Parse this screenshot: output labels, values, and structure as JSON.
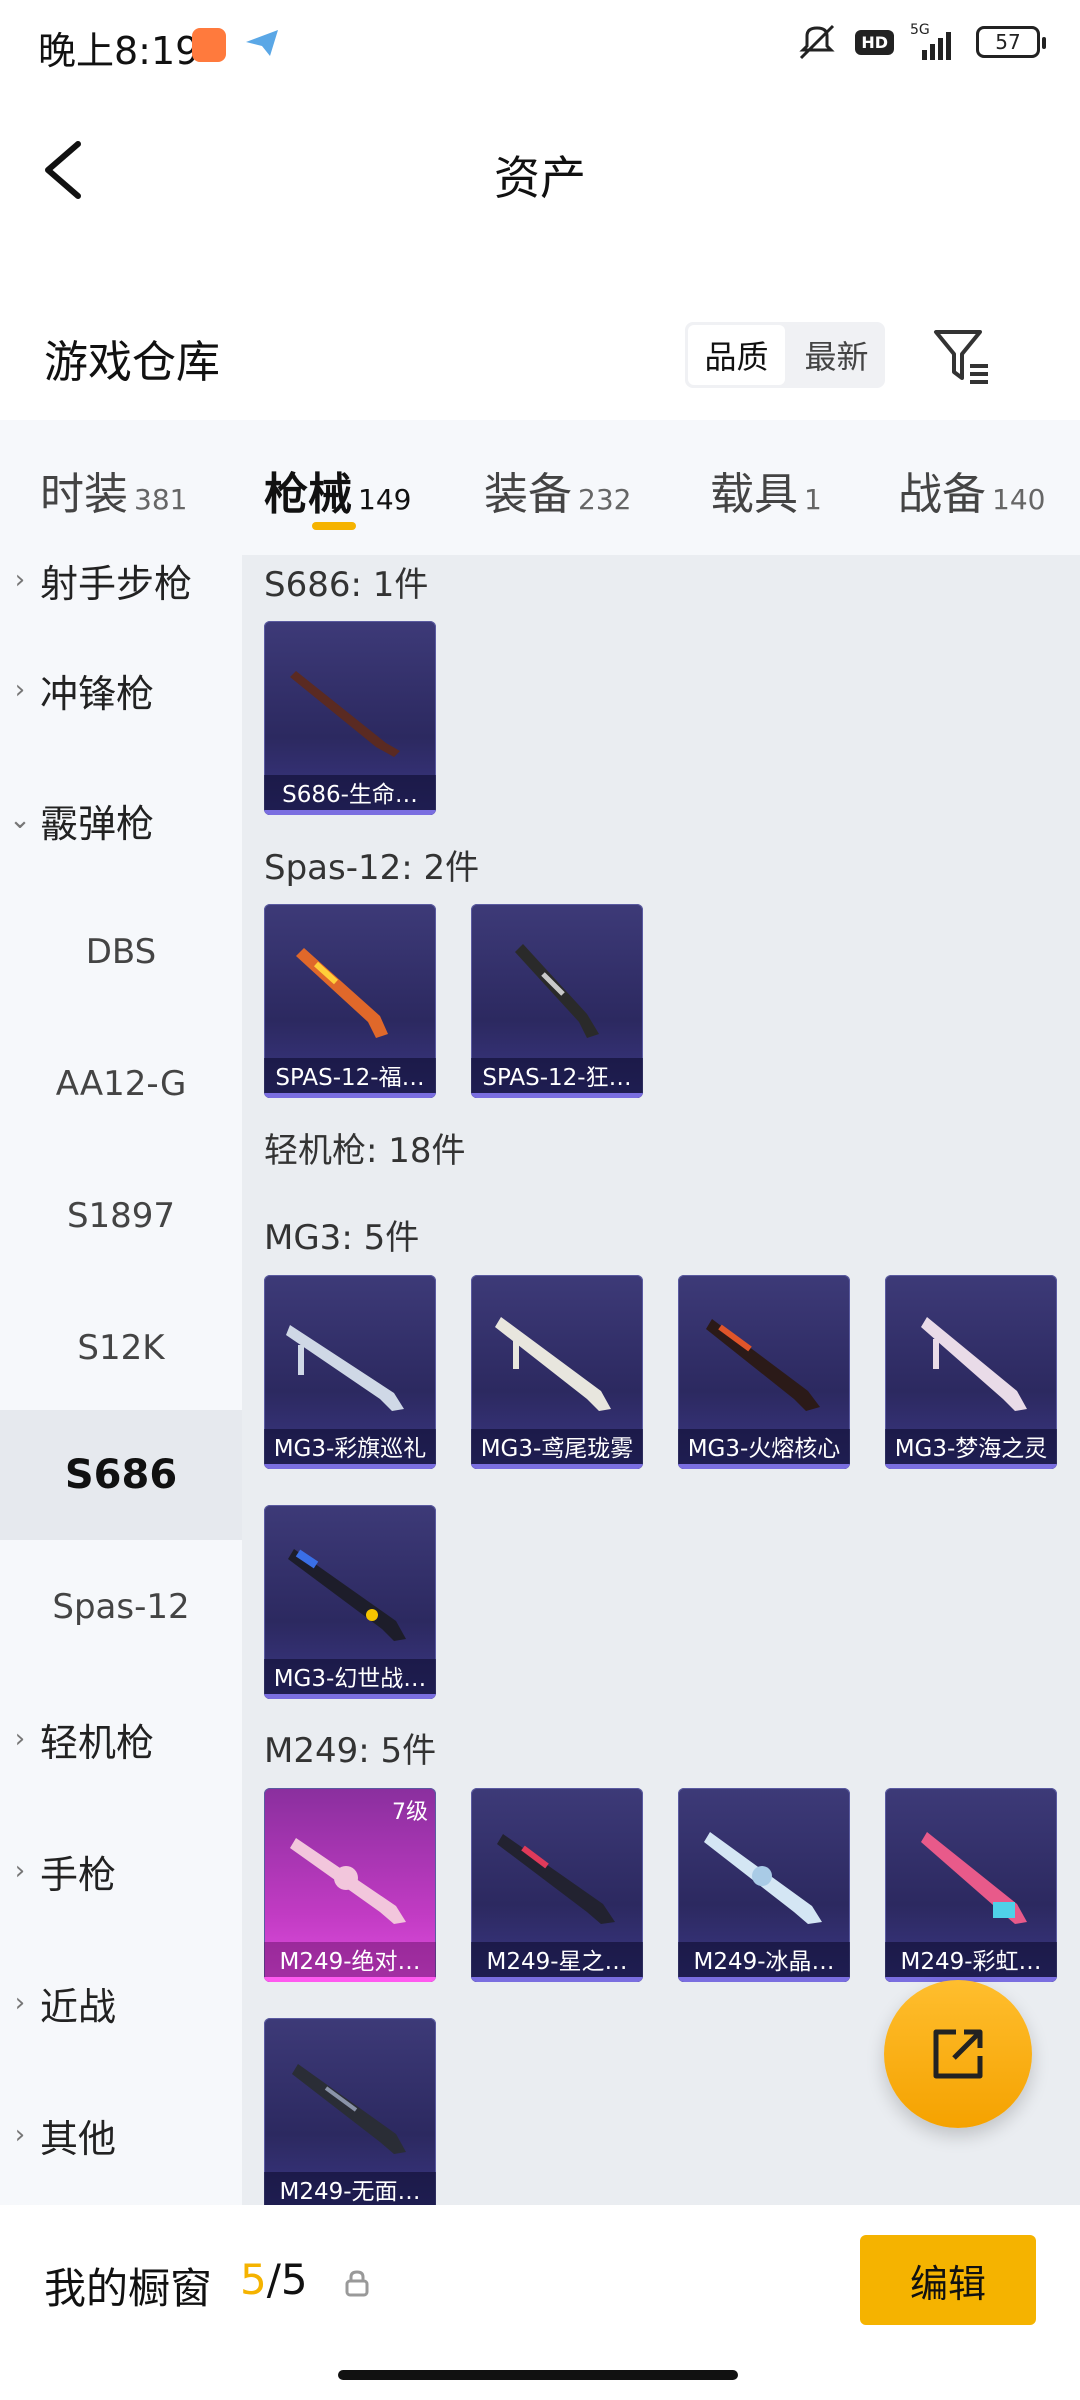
{
  "status_bar": {
    "time": "晚上8:19",
    "hd": "HD",
    "network": "5G",
    "battery": "57"
  },
  "nav": {
    "title": "资产"
  },
  "section": {
    "title": "游戏仓库"
  },
  "sort": {
    "quality": "品质",
    "latest": "最新"
  },
  "tabs": [
    {
      "label": "时装",
      "count": "381"
    },
    {
      "label": "枪械",
      "count": "149"
    },
    {
      "label": "装备",
      "count": "232"
    },
    {
      "label": "载具",
      "count": "1"
    },
    {
      "label": "战备",
      "count": "140"
    }
  ],
  "sidebar": {
    "partial_top": "射手步枪",
    "items": [
      {
        "label": "冲锋枪"
      },
      {
        "label": "霰弹枪"
      },
      {
        "label": "DBS"
      },
      {
        "label": "AA12-G"
      },
      {
        "label": "S1897"
      },
      {
        "label": "S12K"
      },
      {
        "label": "S686"
      },
      {
        "label": "Spas-12"
      },
      {
        "label": "轻机枪"
      },
      {
        "label": "手枪"
      },
      {
        "label": "近战"
      },
      {
        "label": "其他"
      }
    ]
  },
  "content": {
    "groups": {
      "s686": {
        "title": "S686: 1件",
        "cards": [
          "S686-生命…"
        ]
      },
      "spas12": {
        "title": "Spas-12: 2件",
        "cards": [
          "SPAS-12-福…",
          "SPAS-12-狂…"
        ]
      },
      "lmg": {
        "title": "轻机枪: 18件"
      },
      "mg3": {
        "title": "MG3: 5件",
        "cards": [
          "MG3-彩旗巡礼",
          "MG3-鸢尾珑雾",
          "MG3-火熔核心",
          "MG3-梦海之灵",
          "MG3-幻世战…"
        ]
      },
      "m249": {
        "title": "M249: 5件",
        "cards": [
          "M249-绝对…",
          "M249-星之…",
          "M249-冰晶…",
          "M249-彩虹…",
          "M249-无面…"
        ],
        "level_badge": "7级"
      }
    }
  },
  "bottom": {
    "window_label": "我的橱窗",
    "current": "5",
    "separator": "/",
    "total": "5",
    "edit_label": "编辑"
  },
  "colors": {
    "accent": "#f5b300",
    "card_bg": "#2c2960",
    "card_rare": "#c13bc3"
  }
}
